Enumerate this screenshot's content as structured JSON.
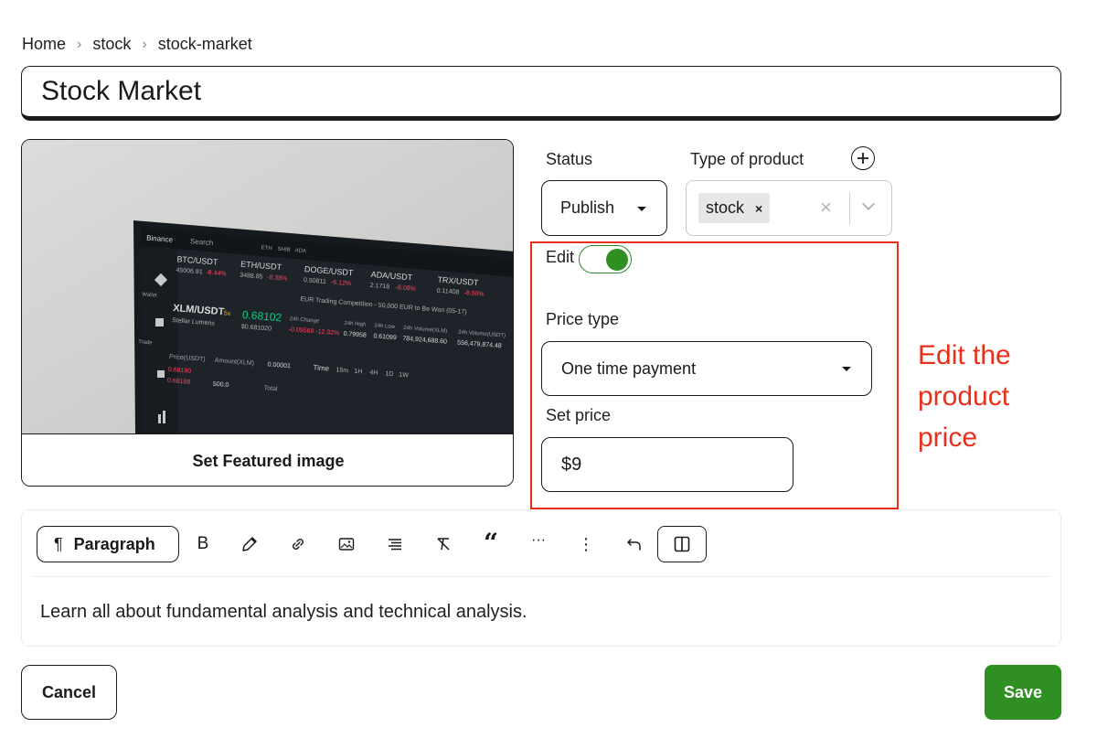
{
  "breadcrumb": {
    "items": [
      "Home",
      "stock",
      "stock-market"
    ],
    "separator": "›"
  },
  "title": {
    "value": "Stock Market"
  },
  "featured_image": {
    "button_label": "Set Featured image",
    "screen_text": {
      "brand": "Binance",
      "search": "Search",
      "tickers": [
        "ETH",
        "SHIB",
        "ADA"
      ],
      "pairs": [
        {
          "name": "BTC/USDT",
          "price": "45006.91",
          "change": "-8.44%"
        },
        {
          "name": "ETH/USDT",
          "price": "3488.85",
          "change": "-8.38%"
        },
        {
          "name": "DOGE/USDT",
          "price": "0.50811",
          "change": "-6.12%"
        },
        {
          "name": "ADA/USDT",
          "price": "2.1718",
          "change": "-8.08%"
        },
        {
          "name": "TRX/USDT",
          "price": "0.11408",
          "change": "-8.00%"
        }
      ],
      "banner": "EUR Trading Competition - 50,000 EUR to Be Won (05-17)",
      "main_pair": "XLM/USDT",
      "main_badge": "5x",
      "main_sub": "Stellar Lumens",
      "main_price": "0.68102",
      "main_price_sub": "$0.681020",
      "change_label": "24h Change",
      "change_value": "-0.09569 -12.32%",
      "high_label": "24h High",
      "high_value": "0.79958",
      "low_label": "24h Low",
      "low_value": "0.61099",
      "vol_label": "24h Volume(XLM)",
      "vol_value": "784,924,688.60",
      "vol2_label": "24h Volume(USDT)",
      "vol2_value": "556,479,874.48",
      "price_col": "Price(USDT)",
      "amount_col": "Amount(XLM)",
      "total_col": "Total",
      "precision": "0.00001",
      "time_label": "Time",
      "intervals": [
        "15m",
        "1H",
        "4H",
        "1D",
        "1W"
      ],
      "row_prices": [
        "0.68190",
        "0.68188"
      ],
      "row_amount": "500.0",
      "side_labels": [
        "Wallet",
        "Trade"
      ]
    }
  },
  "status": {
    "label": "Status",
    "value": "Publish"
  },
  "type_of_product": {
    "label": "Type of product",
    "chip": "stock",
    "chip_remove": "×",
    "clear": "×"
  },
  "edit_toggle": {
    "label": "Edit",
    "on": true
  },
  "price_type": {
    "label": "Price type",
    "value": "One time payment"
  },
  "set_price": {
    "label": "Set price",
    "value": "$9"
  },
  "annotation": {
    "lines": [
      "Edit the",
      "product",
      "price"
    ]
  },
  "editor": {
    "block_type": "Paragraph",
    "pilcrow": "¶",
    "bold": "B",
    "quote": "“",
    "more": "···",
    "options": "⋮",
    "content": "Learn all about fundamental analysis and technical analysis."
  },
  "actions": {
    "cancel": "Cancel",
    "save": "Save"
  },
  "colors": {
    "accent_green": "#2f8f22",
    "annotation_red": "#e8301c",
    "border_dark": "#1a1a1a"
  },
  "icons": [
    "plus-circle-icon",
    "chevron-down-icon",
    "pilcrow-icon",
    "bold-icon",
    "pencil-icon",
    "link-icon",
    "image-icon",
    "align-icon",
    "clear-format-icon",
    "quote-icon",
    "ellipsis-icon",
    "vertical-dots-icon",
    "undo-icon",
    "sidebar-icon"
  ]
}
